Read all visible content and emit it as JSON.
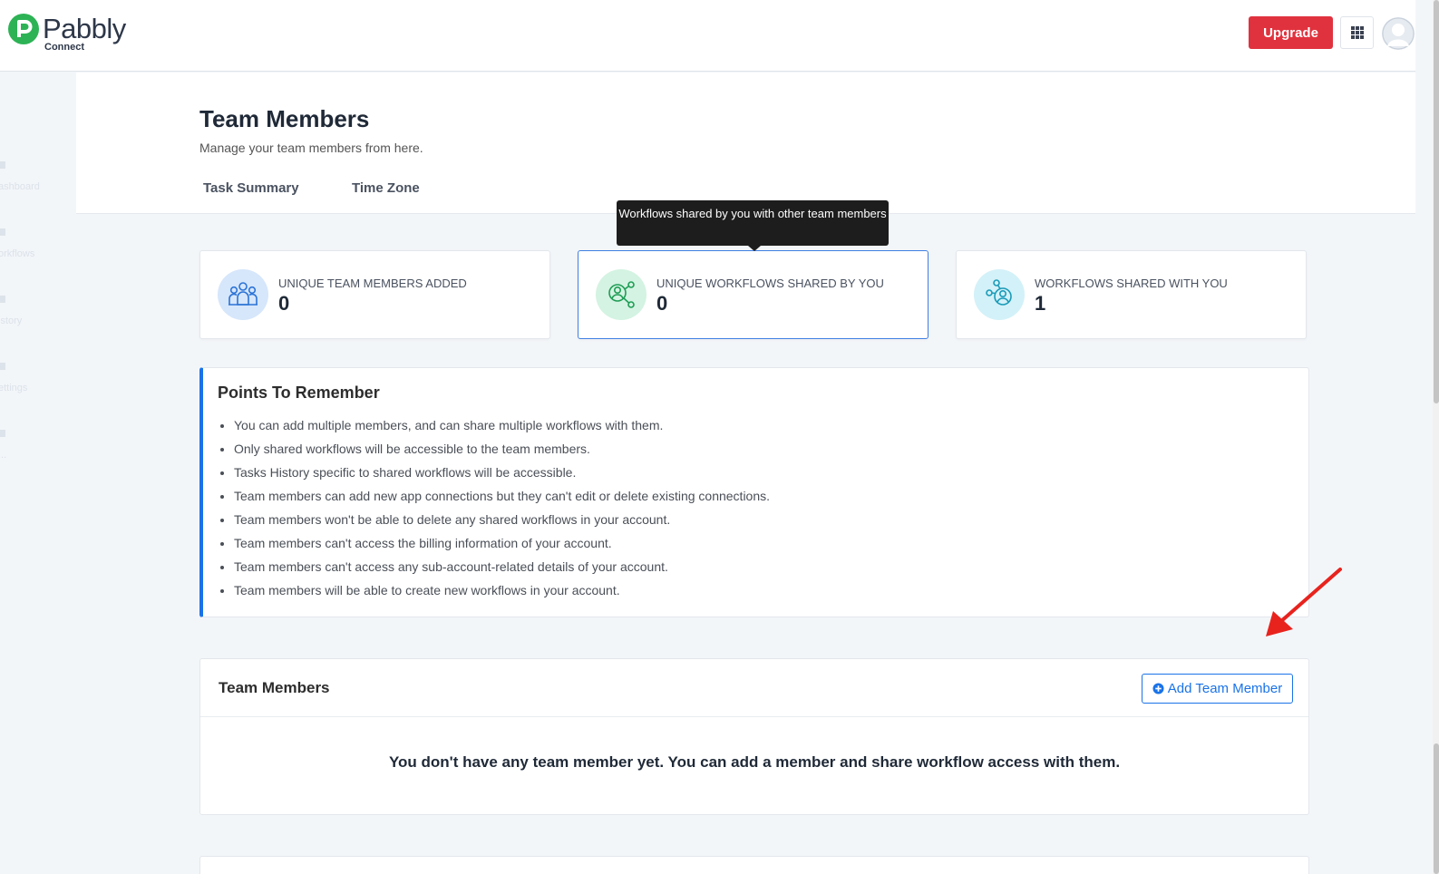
{
  "brand": {
    "name": "Pabbly",
    "product": "Connect",
    "color": "#2db355"
  },
  "header": {
    "upgrade_label": "Upgrade",
    "upgrade_color": "#e0323e"
  },
  "sidebar": {
    "items": [
      {
        "label": "ashboard",
        "icon": "home-icon"
      },
      {
        "label": "orkflows",
        "icon": "workflow-icon"
      },
      {
        "label": "istory",
        "icon": "list-icon"
      },
      {
        "label": "ettings",
        "icon": "gear-icon"
      },
      {
        "label": "...",
        "icon": "help-icon"
      }
    ]
  },
  "page": {
    "title": "Team Members",
    "subtitle": "Manage your team members from here.",
    "tabs": [
      {
        "label": "Task Summary"
      },
      {
        "label": "Time Zone"
      }
    ]
  },
  "tooltip": {
    "text": "Workflows shared by you with other team members"
  },
  "stats": [
    {
      "label": "UNIQUE TEAM MEMBERS ADDED",
      "value": "0",
      "icon": "team-icon",
      "icon_bg": "#d6e6fb",
      "icon_color": "#2b74d6"
    },
    {
      "label": "UNIQUE WORKFLOWS SHARED BY YOU",
      "value": "0",
      "icon": "share-user-icon",
      "icon_bg": "#d4f3e2",
      "icon_color": "#1f9d55"
    },
    {
      "label": "WORKFLOWS SHARED WITH YOU",
      "value": "1",
      "icon": "share-user-icon",
      "icon_bg": "#d3f1f8",
      "icon_color": "#1a9bb8"
    }
  ],
  "points": {
    "title": "Points To Remember",
    "items": [
      "You can add multiple members, and can share multiple workflows with them.",
      "Only shared workflows will be accessible to the team members.",
      "Tasks History specific to shared workflows will be accessible.",
      "Team members can add new app connections but they can't edit or delete existing connections.",
      "Team members won't be able to delete any shared workflows in your account.",
      "Team members can't access the billing information of your account.",
      "Team members can't access any sub-account-related details of your account.",
      "Team members will be able to create new workflows in your account."
    ],
    "accent": "#1a73e8"
  },
  "team_members": {
    "title": "Team Members",
    "add_label": "Add Team Member",
    "empty_message": "You don't have any team member yet. You can add a member and share workflow access with them."
  }
}
